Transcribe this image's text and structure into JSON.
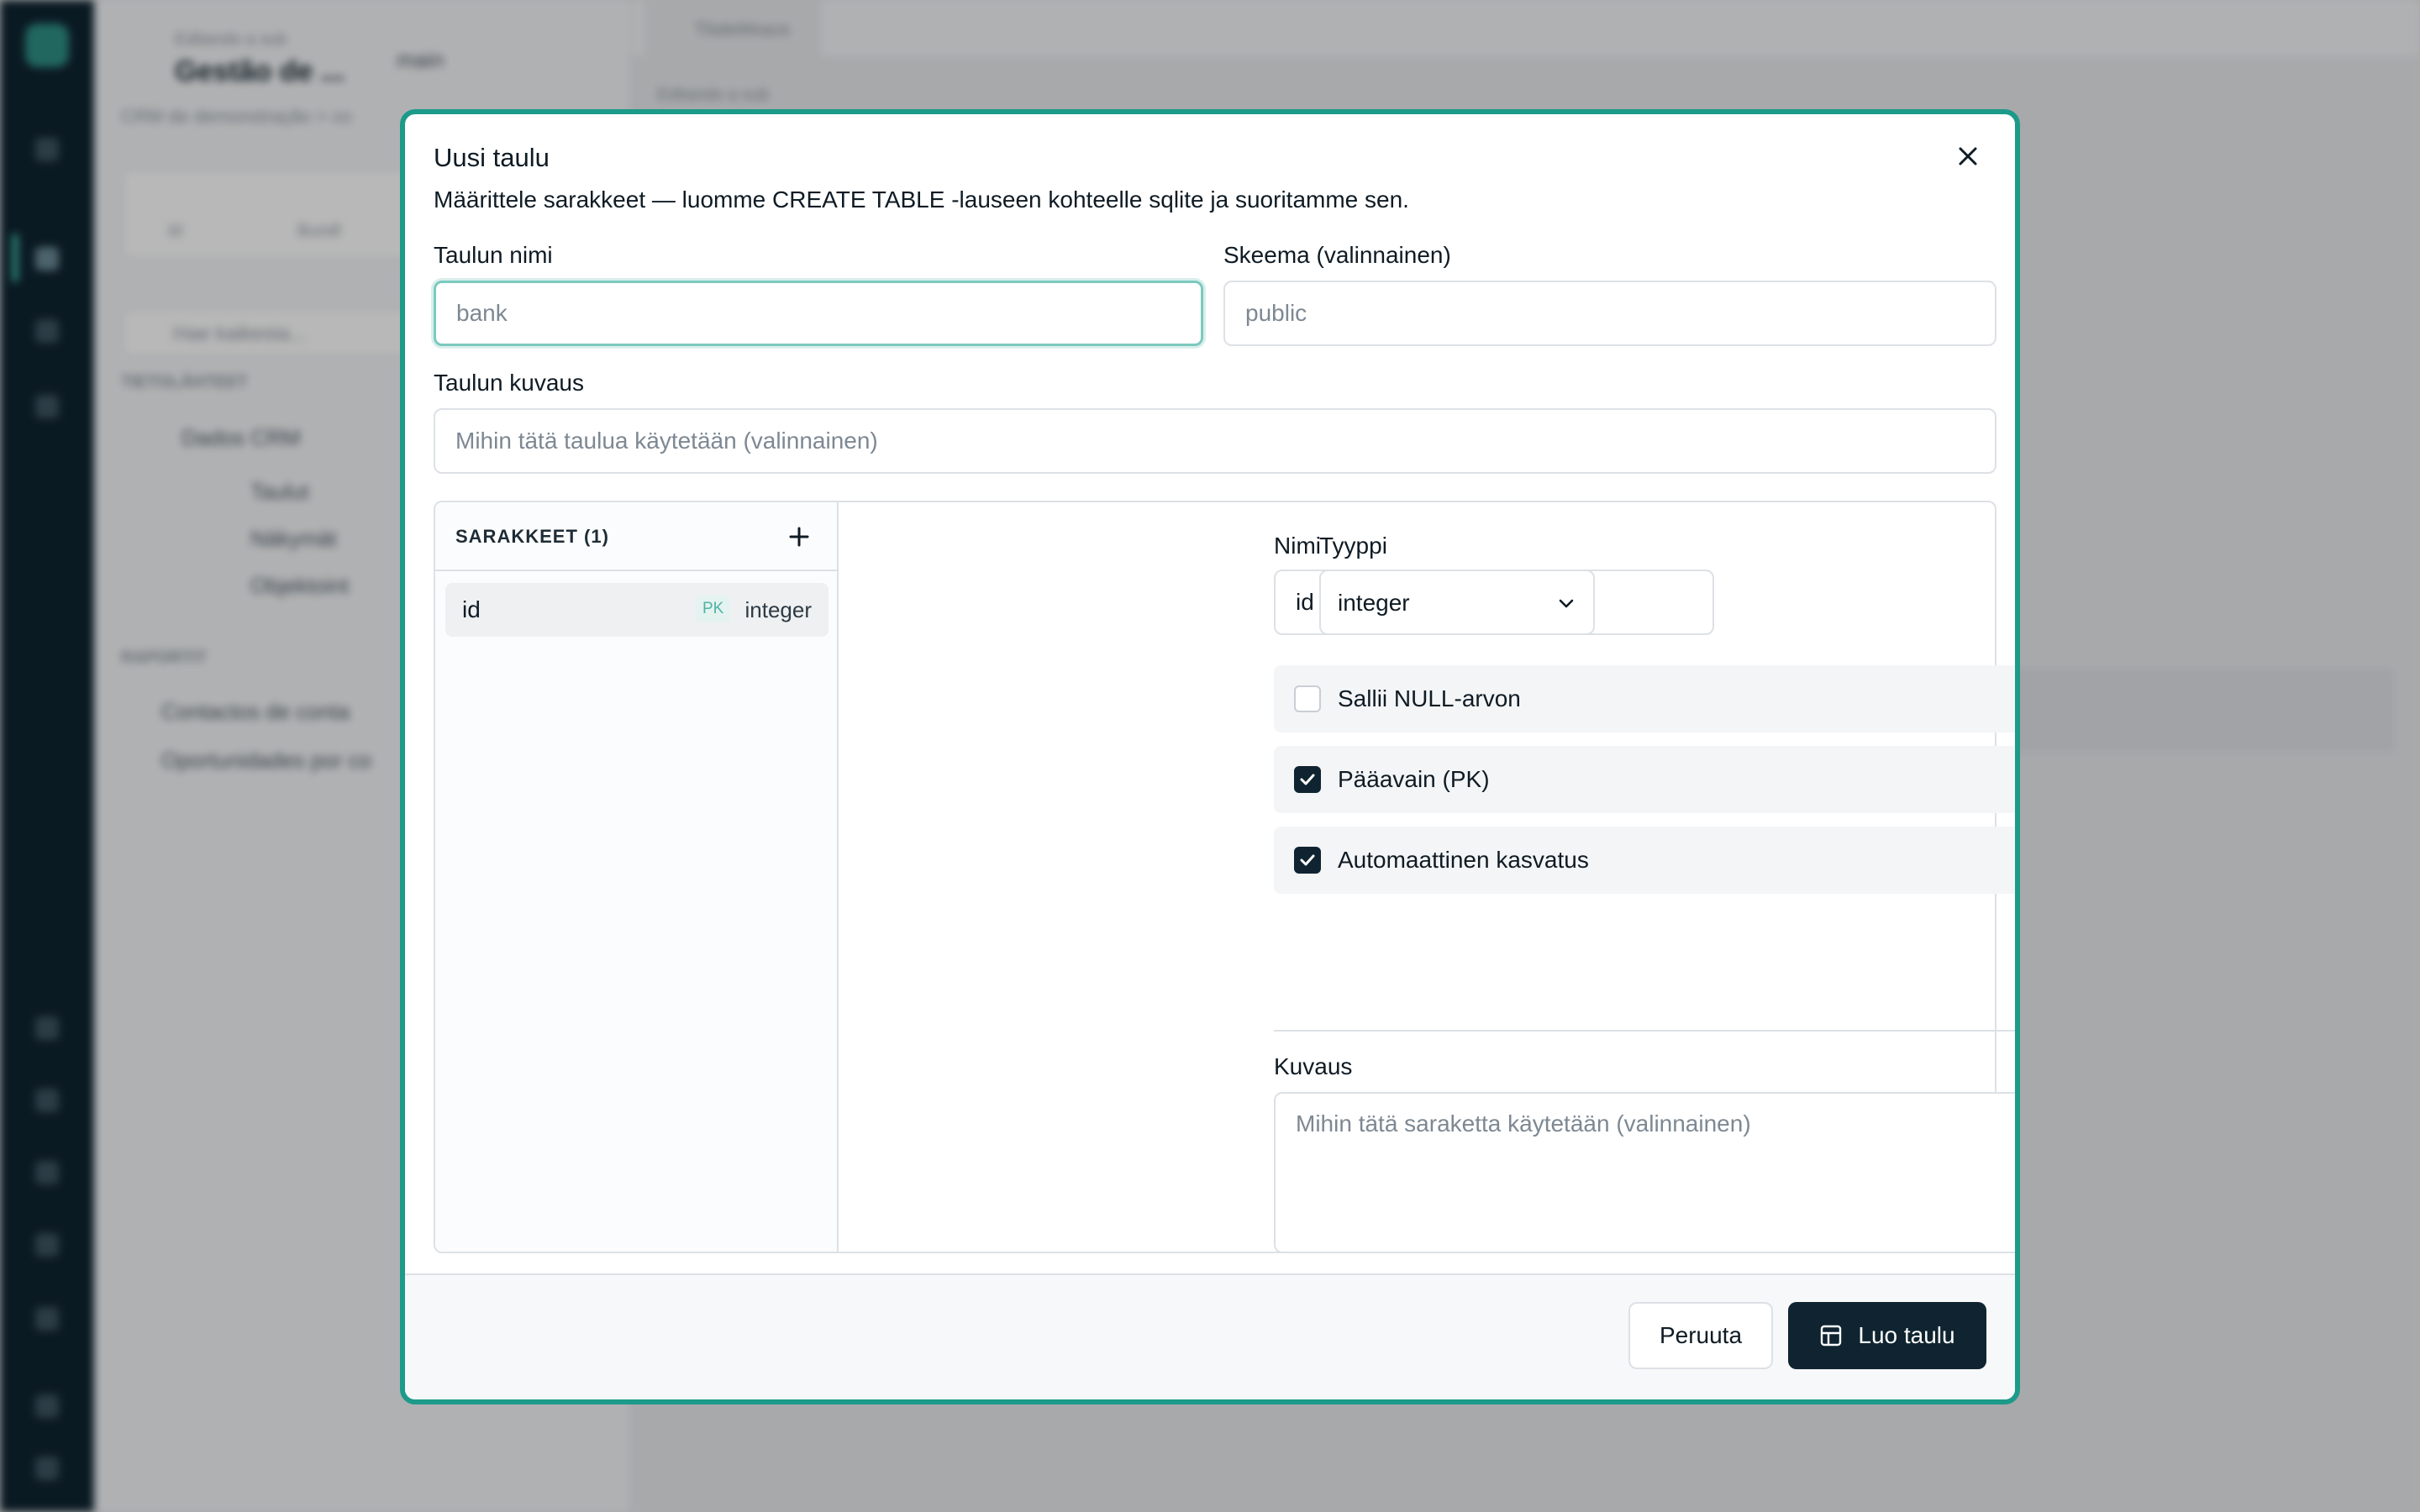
{
  "background": {
    "sidebar": {
      "breadcrumb": "Editando a sub",
      "project_title": "Gestão de ...",
      "branch": "main",
      "subtitle": "CRM de demonstração > co",
      "tabs": [
        "Id",
        "Bundl"
      ],
      "search_placeholder": "Hae kaikesta...",
      "section_data": "TIETOLÄHTEET",
      "tree": [
        "Dados CRM",
        "Taulut",
        "Näkymät",
        "Objektoint"
      ],
      "section_reports": "RAPORTIT",
      "reports": [
        "Contactos de conta",
        "Oportunidades por co"
      ]
    },
    "main": {
      "tab": "Tilaleikkaus",
      "crumb": "Editando a sub"
    }
  },
  "modal": {
    "title": "Uusi taulu",
    "description": "Määrittele sarakkeet — luomme CREATE TABLE -lauseen kohteelle sqlite ja suoritamme sen.",
    "table_name_label": "Taulun nimi",
    "table_name_placeholder": "bank",
    "schema_label": "Skeema (valinnainen)",
    "schema_placeholder": "public",
    "table_desc_label": "Taulun kuvaus",
    "table_desc_placeholder": "Mihin tätä taulua käytetään (valinnainen)",
    "columns_header": "SARAKKEET (1)",
    "columns": [
      {
        "name": "id",
        "badge": "PK",
        "type": "integer"
      }
    ],
    "column_detail": {
      "name_label": "Nimi",
      "name_value": "id",
      "type_label": "Tyyppi",
      "type_value": "integer",
      "options": [
        {
          "label": "Sallii NULL-arvon",
          "checked": false
        },
        {
          "label": "Pääavain (PK)",
          "checked": true
        },
        {
          "label": "Automaattinen kasvatus",
          "checked": true
        }
      ],
      "desc_label": "Kuvaus",
      "desc_placeholder": "Mihin tätä saraketta käytetään (valinnainen)"
    },
    "cancel_label": "Peruuta",
    "create_label": "Luo taulu"
  },
  "colors": {
    "accent": "#1c9a8a",
    "primary": "#0f2430"
  }
}
